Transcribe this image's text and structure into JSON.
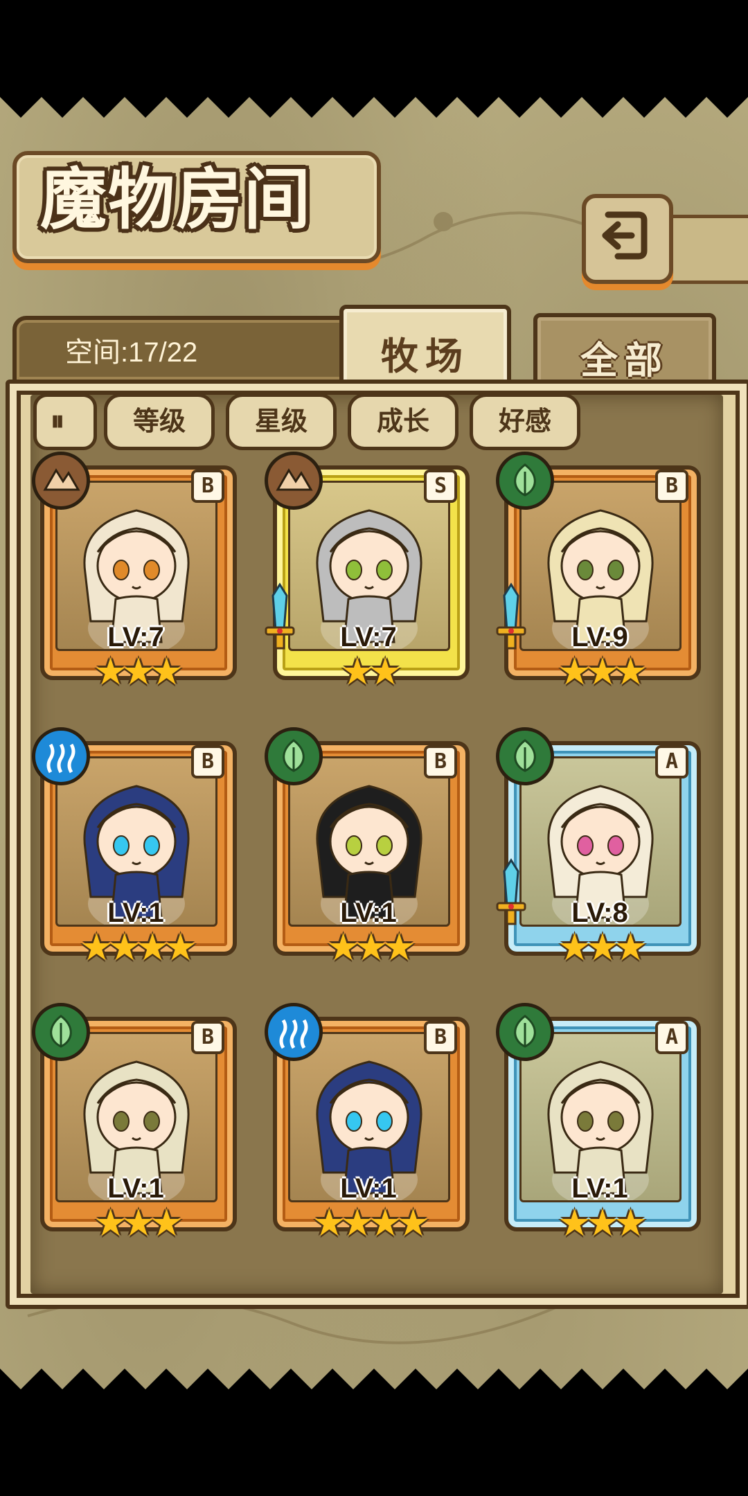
{
  "title": "魔物房间",
  "space": {
    "label": "空间:17/22"
  },
  "tabs": [
    {
      "label": "牧场",
      "active": true
    },
    {
      "label": "全部",
      "active": false
    }
  ],
  "sort_buttons": [
    {
      "label": "等级"
    },
    {
      "label": "星级"
    },
    {
      "label": "成长"
    },
    {
      "label": "好感"
    }
  ],
  "colors": {
    "orange_frame": "#e48c34",
    "yellow_frame": "#f3e24a",
    "blue_frame": "#8fd3ec",
    "star": "#ffc21a",
    "border": "#4d3519"
  },
  "monsters": [
    {
      "level": "LV:7",
      "rank": "B",
      "stars": "★★★",
      "element": "earth-icon",
      "frame": "orange",
      "weapon": false
    },
    {
      "level": "LV:7",
      "rank": "S",
      "stars": "★★",
      "element": "earth-icon",
      "frame": "yellow",
      "weapon": true
    },
    {
      "level": "LV:9",
      "rank": "B",
      "stars": "★★★",
      "element": "leaf-icon",
      "frame": "orange",
      "weapon": true
    },
    {
      "level": "LV:1",
      "rank": "B",
      "stars": "★★★★",
      "element": "water-icon",
      "frame": "orange",
      "weapon": false
    },
    {
      "level": "LV:1",
      "rank": "B",
      "stars": "★★★",
      "element": "leaf-icon",
      "frame": "orange",
      "weapon": false
    },
    {
      "level": "LV:8",
      "rank": "A",
      "stars": "★★★",
      "element": "leaf-icon",
      "frame": "blue",
      "weapon": true
    },
    {
      "level": "LV:1",
      "rank": "B",
      "stars": "★★★",
      "element": "leaf-icon",
      "frame": "orange",
      "weapon": false
    },
    {
      "level": "LV:1",
      "rank": "B",
      "stars": "★★★★",
      "element": "water-icon",
      "frame": "orange",
      "weapon": false
    },
    {
      "level": "LV:1",
      "rank": "A",
      "stars": "★★★",
      "element": "leaf-icon",
      "frame": "blue",
      "weapon": false
    }
  ]
}
